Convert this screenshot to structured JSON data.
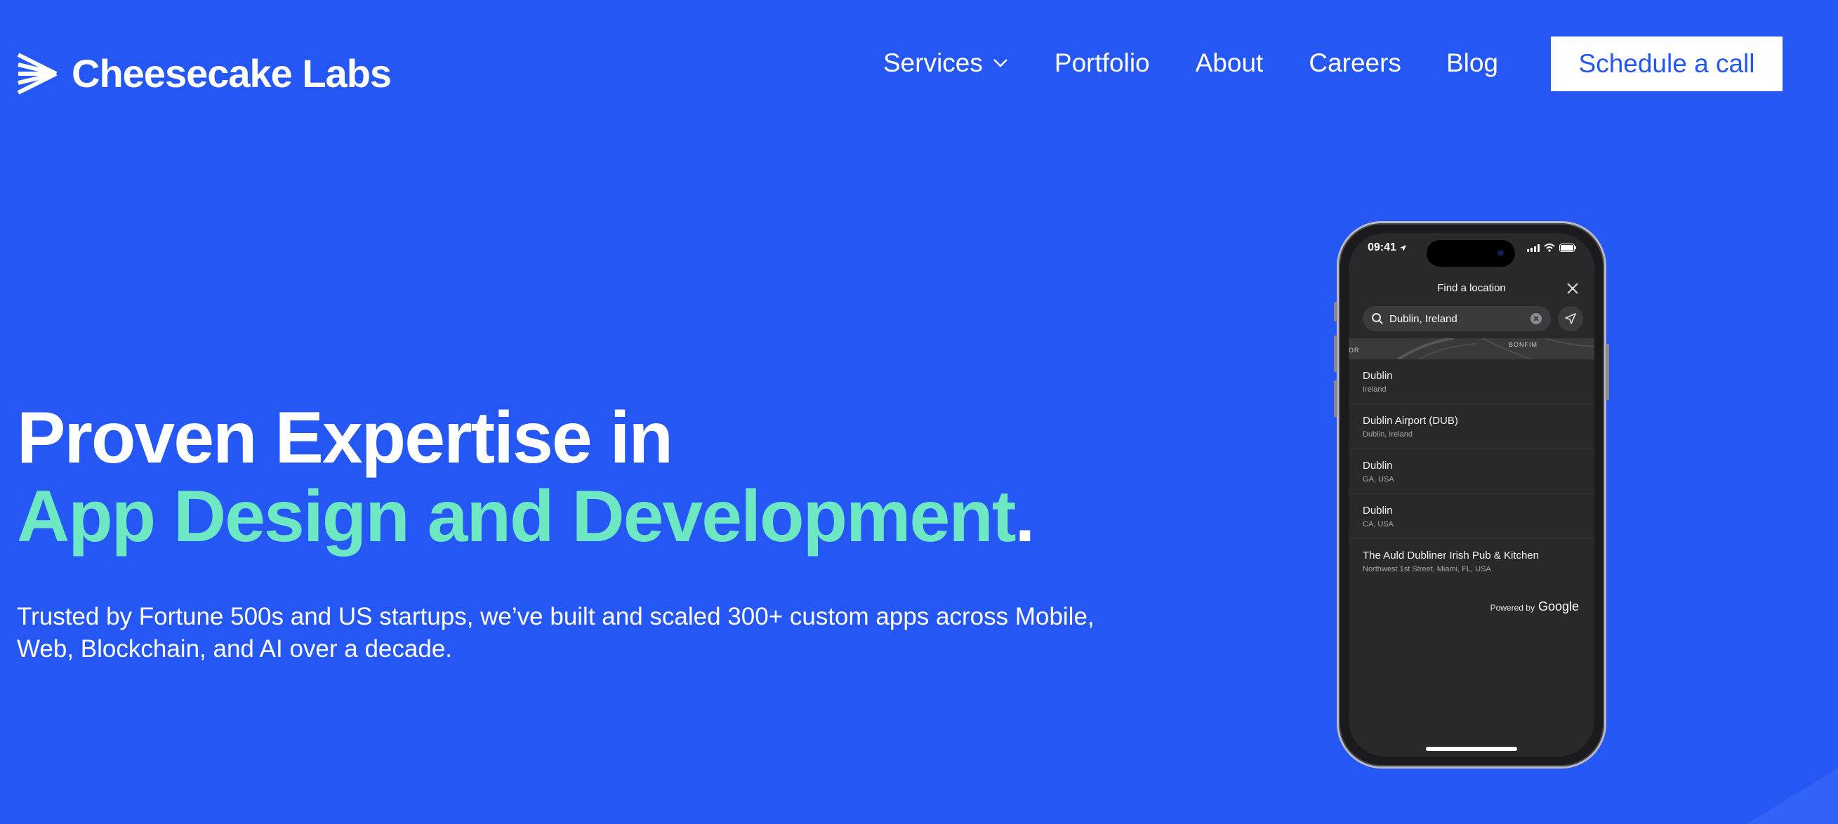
{
  "header": {
    "brand": "Cheesecake Labs",
    "logo_icon": "cheesecake-labs-logo",
    "nav": {
      "services": "Services",
      "portfolio": "Portfolio",
      "about": "About",
      "careers": "Careers",
      "blog": "Blog"
    },
    "cta": "Schedule a call"
  },
  "hero": {
    "title_line1": "Proven Expertise in",
    "title_line2": "App Design and Development",
    "title_period": ".",
    "subtitle": "Trusted by Fortune 500s and US startups, we’ve built and scaled 300+ custom apps across Mobile, Web, Blockchain, and AI over a decade."
  },
  "phone": {
    "time": "09:41",
    "modal_title": "Find a location",
    "search_value": "Dublin, Ireland",
    "map_label_left": "OR",
    "map_label_right": "BONFIM",
    "results": [
      {
        "name": "Dublin",
        "sub": "Ireland"
      },
      {
        "name": "Dublin Airport (DUB)",
        "sub": "Dublin, Ireland"
      },
      {
        "name": "Dublin",
        "sub": "GA, USA"
      },
      {
        "name": "Dublin",
        "sub": "CA, USA"
      },
      {
        "name": "The Auld Dubliner Irish Pub & Kitchen",
        "sub": "Northwest 1st Street, Miami, FL, USA"
      }
    ],
    "powered_by": "Powered by",
    "powered_brand": "Google"
  },
  "colors": {
    "background": "#2557F5",
    "accent": "#6EE7C3",
    "text": "#FFFFFF"
  }
}
